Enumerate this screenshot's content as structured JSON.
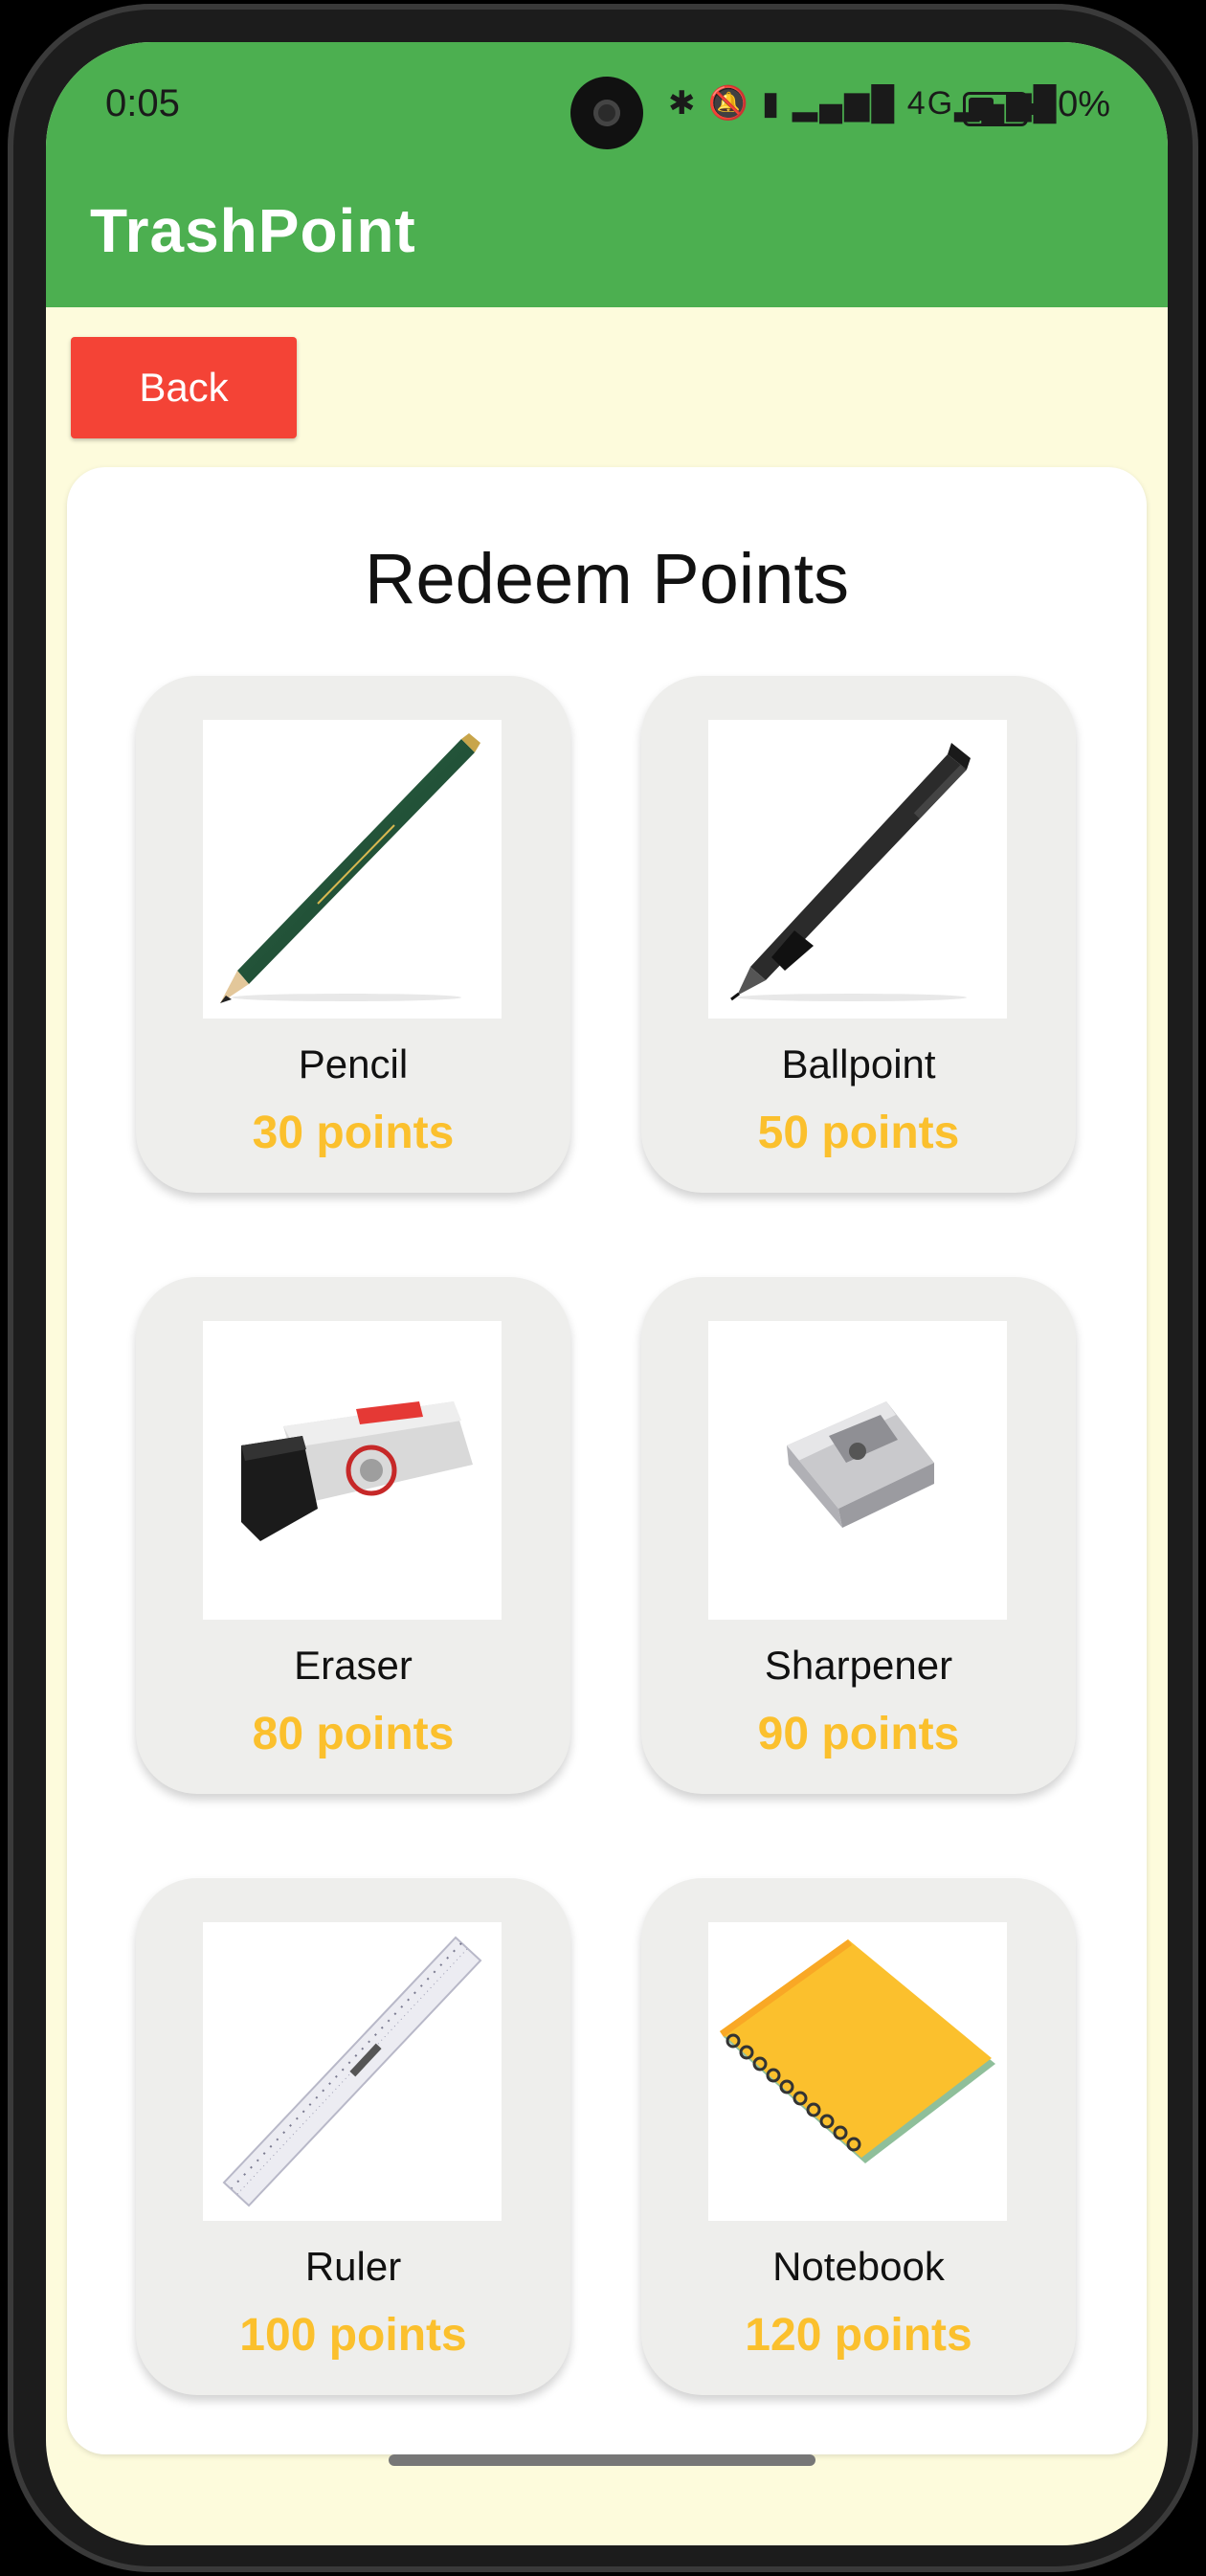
{
  "status_bar": {
    "time": "0:05",
    "icons": "✱ 🔕 ▮ ▂▄▆█ 4G▂▄▆█",
    "battery": "50%"
  },
  "app": {
    "title": "TrashPoint"
  },
  "back_label": "Back",
  "page_title": "Redeem Points",
  "items": [
    {
      "name": "Pencil",
      "points": "30 points",
      "icon": "pencil-image"
    },
    {
      "name": "Ballpoint",
      "points": "50 points",
      "icon": "ballpoint-pen-image"
    },
    {
      "name": "Eraser",
      "points": "80 points",
      "icon": "eraser-image"
    },
    {
      "name": "Sharpener",
      "points": "90 points",
      "icon": "sharpener-image"
    },
    {
      "name": "Ruler",
      "points": "100 points",
      "icon": "ruler-image"
    },
    {
      "name": "Notebook",
      "points": "120 points",
      "icon": "notebook-image"
    }
  ],
  "colors": {
    "appbar": "#4caf50",
    "back_button": "#f44336",
    "points": "#fbc02d",
    "background": "#fdfbdc"
  }
}
